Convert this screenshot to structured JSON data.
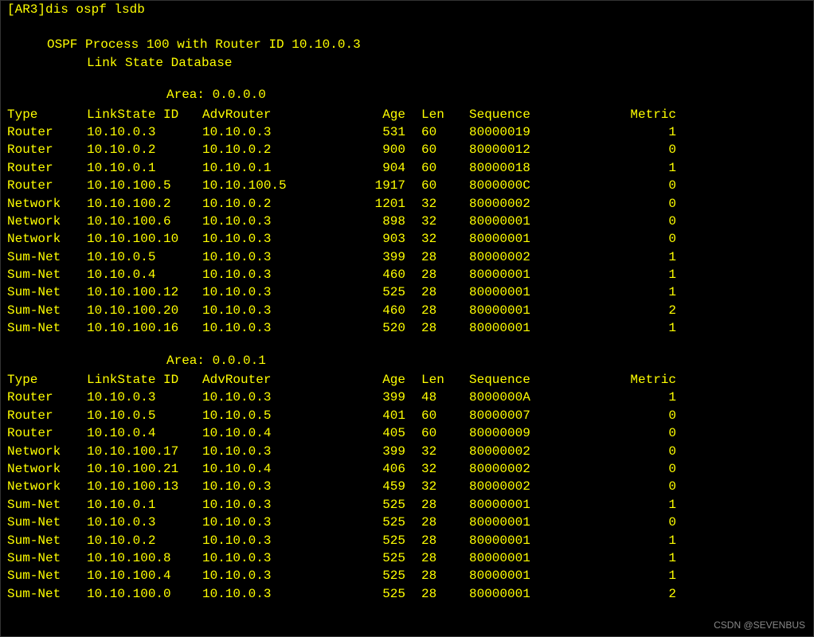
{
  "prompt": "[AR3]",
  "command": "dis ospf lsdb",
  "header1": "OSPF Process 100 with Router ID 10.10.0.3",
  "header2": "Link State Database",
  "watermark": "CSDN @SEVENBUS",
  "columns": {
    "type": "Type",
    "lsid": "LinkState ID",
    "advr": "AdvRouter",
    "age": "Age",
    "len": "Len",
    "seq": "Sequence",
    "metric": "Metric"
  },
  "areas": [
    {
      "title": "Area: 0.0.0.0",
      "rows": [
        {
          "type": "Router",
          "lsid": "10.10.0.3",
          "advr": "10.10.0.3",
          "age": "531",
          "len": "60",
          "seq": "80000019",
          "metric": "1"
        },
        {
          "type": "Router",
          "lsid": "10.10.0.2",
          "advr": "10.10.0.2",
          "age": "900",
          "len": "60",
          "seq": "80000012",
          "metric": "0"
        },
        {
          "type": "Router",
          "lsid": "10.10.0.1",
          "advr": "10.10.0.1",
          "age": "904",
          "len": "60",
          "seq": "80000018",
          "metric": "1"
        },
        {
          "type": "Router",
          "lsid": "10.10.100.5",
          "advr": "10.10.100.5",
          "age": "1917",
          "len": "60",
          "seq": "8000000C",
          "metric": "0"
        },
        {
          "type": "Network",
          "lsid": "10.10.100.2",
          "advr": "10.10.0.2",
          "age": "1201",
          "len": "32",
          "seq": "80000002",
          "metric": "0"
        },
        {
          "type": "Network",
          "lsid": "10.10.100.6",
          "advr": "10.10.0.3",
          "age": "898",
          "len": "32",
          "seq": "80000001",
          "metric": "0"
        },
        {
          "type": "Network",
          "lsid": "10.10.100.10",
          "advr": "10.10.0.3",
          "age": "903",
          "len": "32",
          "seq": "80000001",
          "metric": "0"
        },
        {
          "type": "Sum-Net",
          "lsid": "10.10.0.5",
          "advr": "10.10.0.3",
          "age": "399",
          "len": "28",
          "seq": "80000002",
          "metric": "1"
        },
        {
          "type": "Sum-Net",
          "lsid": "10.10.0.4",
          "advr": "10.10.0.3",
          "age": "460",
          "len": "28",
          "seq": "80000001",
          "metric": "1"
        },
        {
          "type": "Sum-Net",
          "lsid": "10.10.100.12",
          "advr": "10.10.0.3",
          "age": "525",
          "len": "28",
          "seq": "80000001",
          "metric": "1"
        },
        {
          "type": "Sum-Net",
          "lsid": "10.10.100.20",
          "advr": "10.10.0.3",
          "age": "460",
          "len": "28",
          "seq": "80000001",
          "metric": "2"
        },
        {
          "type": "Sum-Net",
          "lsid": "10.10.100.16",
          "advr": "10.10.0.3",
          "age": "520",
          "len": "28",
          "seq": "80000001",
          "metric": "1"
        }
      ]
    },
    {
      "title": "Area: 0.0.0.1",
      "rows": [
        {
          "type": "Router",
          "lsid": "10.10.0.3",
          "advr": "10.10.0.3",
          "age": "399",
          "len": "48",
          "seq": "8000000A",
          "metric": "1"
        },
        {
          "type": "Router",
          "lsid": "10.10.0.5",
          "advr": "10.10.0.5",
          "age": "401",
          "len": "60",
          "seq": "80000007",
          "metric": "0"
        },
        {
          "type": "Router",
          "lsid": "10.10.0.4",
          "advr": "10.10.0.4",
          "age": "405",
          "len": "60",
          "seq": "80000009",
          "metric": "0"
        },
        {
          "type": "Network",
          "lsid": "10.10.100.17",
          "advr": "10.10.0.3",
          "age": "399",
          "len": "32",
          "seq": "80000002",
          "metric": "0"
        },
        {
          "type": "Network",
          "lsid": "10.10.100.21",
          "advr": "10.10.0.4",
          "age": "406",
          "len": "32",
          "seq": "80000002",
          "metric": "0"
        },
        {
          "type": "Network",
          "lsid": "10.10.100.13",
          "advr": "10.10.0.3",
          "age": "459",
          "len": "32",
          "seq": "80000002",
          "metric": "0"
        },
        {
          "type": "Sum-Net",
          "lsid": "10.10.0.1",
          "advr": "10.10.0.3",
          "age": "525",
          "len": "28",
          "seq": "80000001",
          "metric": "1"
        },
        {
          "type": "Sum-Net",
          "lsid": "10.10.0.3",
          "advr": "10.10.0.3",
          "age": "525",
          "len": "28",
          "seq": "80000001",
          "metric": "0"
        },
        {
          "type": "Sum-Net",
          "lsid": "10.10.0.2",
          "advr": "10.10.0.3",
          "age": "525",
          "len": "28",
          "seq": "80000001",
          "metric": "1"
        },
        {
          "type": "Sum-Net",
          "lsid": "10.10.100.8",
          "advr": "10.10.0.3",
          "age": "525",
          "len": "28",
          "seq": "80000001",
          "metric": "1"
        },
        {
          "type": "Sum-Net",
          "lsid": "10.10.100.4",
          "advr": "10.10.0.3",
          "age": "525",
          "len": "28",
          "seq": "80000001",
          "metric": "1"
        },
        {
          "type": "Sum-Net",
          "lsid": "10.10.100.0",
          "advr": "10.10.0.3",
          "age": "525",
          "len": "28",
          "seq": "80000001",
          "metric": "2"
        }
      ]
    }
  ]
}
